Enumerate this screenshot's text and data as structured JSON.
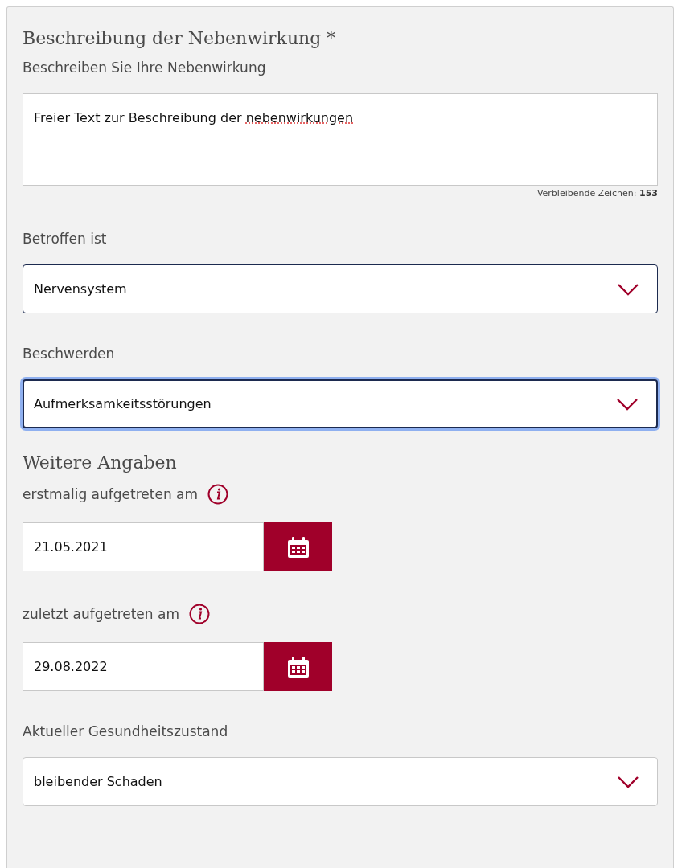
{
  "items": [
    {
      "kind": "heading",
      "text": "Beschreibung der Nebenwirkung *"
    },
    {
      "kind": "textarea",
      "label": "Beschreiben Sie Ihre Nebenwirkung",
      "value": "Freier Text zur Beschreibung der nebenwirkungen",
      "counter_label": "Verbleibende Zeichen:",
      "counter_value": "153"
    },
    {
      "kind": "select",
      "label": "Betroffen ist",
      "value": "Nervensystem",
      "highlighted": true,
      "focused": false
    },
    {
      "kind": "select",
      "label": "Beschwerden",
      "value": "Aufmerksamkeitsstörungen",
      "highlighted": true,
      "focused": true
    },
    {
      "kind": "heading",
      "text": "Weitere Angaben"
    },
    {
      "kind": "date",
      "label": "erstmalig aufgetreten am",
      "value": "21.05.2021",
      "info": true
    },
    {
      "kind": "date",
      "label": "zuletzt aufgetreten am",
      "value": "29.08.2022",
      "info": true
    },
    {
      "kind": "select",
      "label": "Aktueller Gesundheitszustand",
      "value": "bleibender Schaden",
      "highlighted": false,
      "focused": false
    }
  ]
}
